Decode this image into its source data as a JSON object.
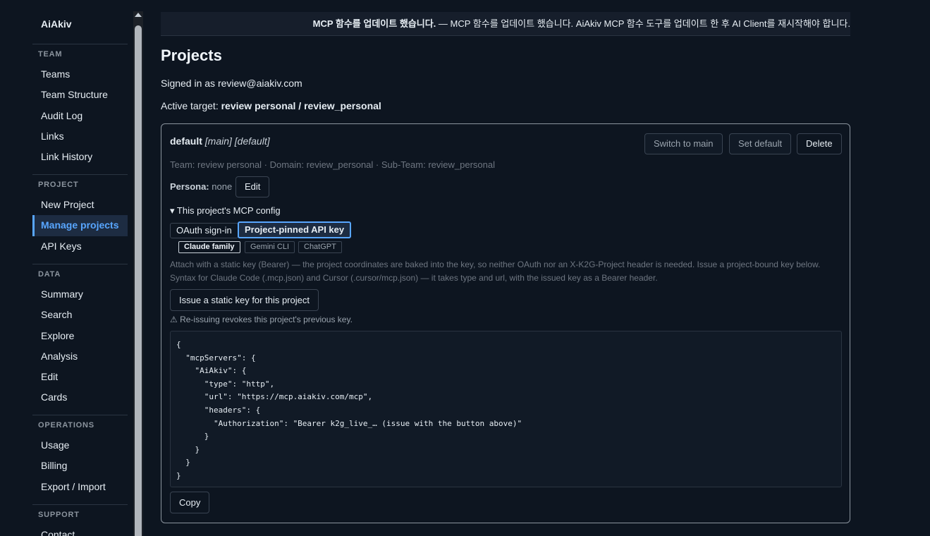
{
  "brand": "AiAkiv",
  "sidebar": {
    "groups": [
      {
        "title": "TEAM",
        "items": [
          "Teams",
          "Team Structure",
          "Audit Log",
          "Links",
          "Link History"
        ]
      },
      {
        "title": "PROJECT",
        "items": [
          "New Project",
          "Manage projects",
          "API Keys"
        ]
      },
      {
        "title": "DATA",
        "items": [
          "Summary",
          "Search",
          "Explore",
          "Analysis",
          "Edit",
          "Cards"
        ]
      },
      {
        "title": "OPERATIONS",
        "items": [
          "Usage",
          "Billing",
          "Export / Import"
        ]
      },
      {
        "title": "SUPPORT",
        "items": [
          "Contact"
        ]
      }
    ],
    "active_item": "Manage projects"
  },
  "banner": {
    "bold": "MCP 함수를 업데이트 했습니다.",
    "rest": " — MCP 함수를 업데이트 했습니다. AiAkiv MCP 함수 도구를 업데이트 한 후 AI Client를 재시작해야 합니다."
  },
  "page": {
    "title": "Projects",
    "signed_in": "Signed in as review@aiakiv.com",
    "active_target_label": "Active target: ",
    "active_target_value": "review personal / review_personal"
  },
  "project": {
    "name": "default",
    "tags": "[main] [default]",
    "buttons": {
      "switch": "Switch to main",
      "set_default": "Set default",
      "delete": "Delete"
    },
    "meta": "Team: review personal · Domain: review_personal · Sub-Team: review_personal",
    "persona_label": "Persona:",
    "persona_value": " none",
    "persona_edit": "Edit",
    "mcp_summary": "▾ This project's MCP config",
    "tabs": [
      "OAuth sign-in",
      "Project-pinned API key"
    ],
    "active_tab": "Project-pinned API key",
    "subtabs": [
      "Claude family",
      "Gemini CLI",
      "ChatGPT"
    ],
    "active_subtab": "Claude family",
    "description": "Attach with a static key (Bearer) — the project coordinates are baked into the key, so neither OAuth nor an X-K2G-Project header is needed. Issue a project-bound key below. Syntax for Claude Code (.mcp.json) and Cursor (.cursor/mcp.json) — it takes type and url, with the issued key as a Bearer header.",
    "issue_button": "Issue a static key for this project",
    "warning": "⚠ Re-issuing revokes this project's previous key.",
    "code": "{\n  \"mcpServers\": {\n    \"AiAkiv\": {\n      \"type\": \"http\",\n      \"url\": \"https://mcp.aiakiv.com/mcp\",\n      \"headers\": {\n        \"Authorization\": \"Bearer k2g_live_… (issue with the button above)\"\n      }\n    }\n  }\n}",
    "copy_button": "Copy"
  },
  "colors": {
    "accent": "#58a6ff",
    "background": "#0d1520",
    "border": "#8b949e"
  }
}
